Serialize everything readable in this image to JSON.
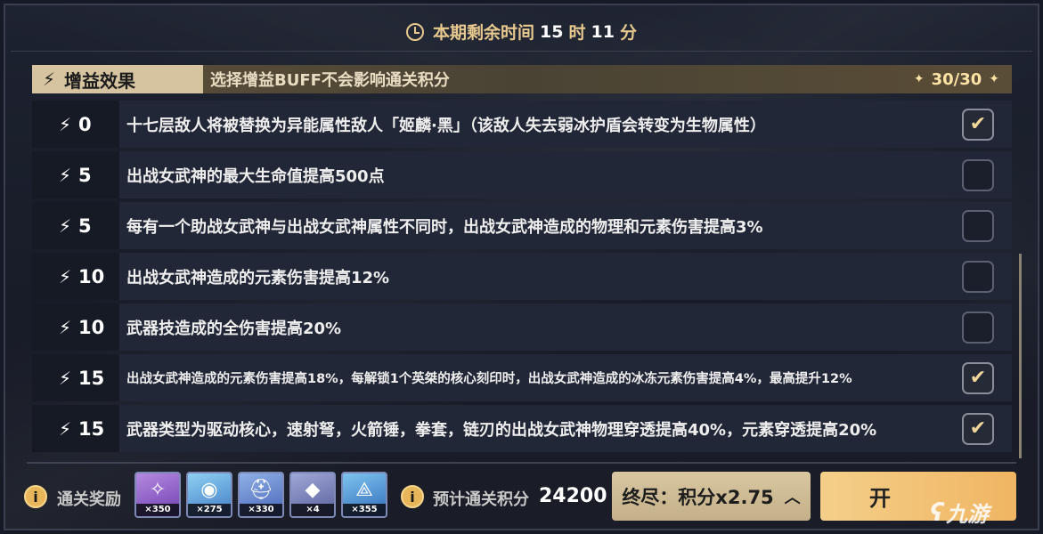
{
  "timer": {
    "prefix": "本期剩余时间",
    "hours": "15",
    "hours_unit": "时",
    "minutes": "11",
    "minutes_unit": "分"
  },
  "buff_header": {
    "tag": "增益效果",
    "description": "选择增益BUFF不会影响通关积分",
    "count": "30/30"
  },
  "buffs": [
    {
      "cost": "0",
      "text": "十七层敌人将被替换为异能属性敌人「姬麟·黑」（该敌人失去弱冰护盾会转变为生物属性）",
      "checked": true
    },
    {
      "cost": "5",
      "text": "出战女武神的最大生命值提高500点",
      "checked": false
    },
    {
      "cost": "5",
      "text": "每有一个助战女武神与出战女武神属性不同时，出战女武神造成的物理和元素伤害提高3%",
      "checked": false
    },
    {
      "cost": "10",
      "text": "出战女武神造成的元素伤害提高12%",
      "checked": false
    },
    {
      "cost": "10",
      "text": "武器技造成的全伤害提高20%",
      "checked": false
    },
    {
      "cost": "15",
      "text": "出战女武神造成的元素伤害提高18%，每解锁1个英桀的核心刻印时，出战女武神造成的冰冻元素伤害提高4%，最高提升12%",
      "checked": true
    },
    {
      "cost": "15",
      "text": "武器类型为驱动核心，速射弩，火箭锤，拳套，链刃的出战女武神物理穿透提高40%，元素穿透提高20%",
      "checked": true
    }
  ],
  "check_mark": "✔",
  "footer": {
    "info_icon": "i",
    "rewards_label": "通关奖励",
    "rewards": [
      {
        "qty": "×350",
        "icon": "crystal-icon",
        "color": "#8a5bc4"
      },
      {
        "qty": "×275",
        "icon": "coin-icon",
        "color": "#4a8fd0"
      },
      {
        "qty": "×330",
        "icon": "helmet-icon",
        "color": "#5a7cc9"
      },
      {
        "qty": "×4",
        "icon": "ore-icon",
        "color": "#6f6fa8"
      },
      {
        "qty": "×355",
        "icon": "emblem-icon",
        "color": "#3d7ec4"
      }
    ],
    "score_label": "预计通关积分",
    "score_value": "24200",
    "difficulty_label": "终尽：积分x2.75",
    "start_label": "开"
  },
  "watermark": "九游"
}
